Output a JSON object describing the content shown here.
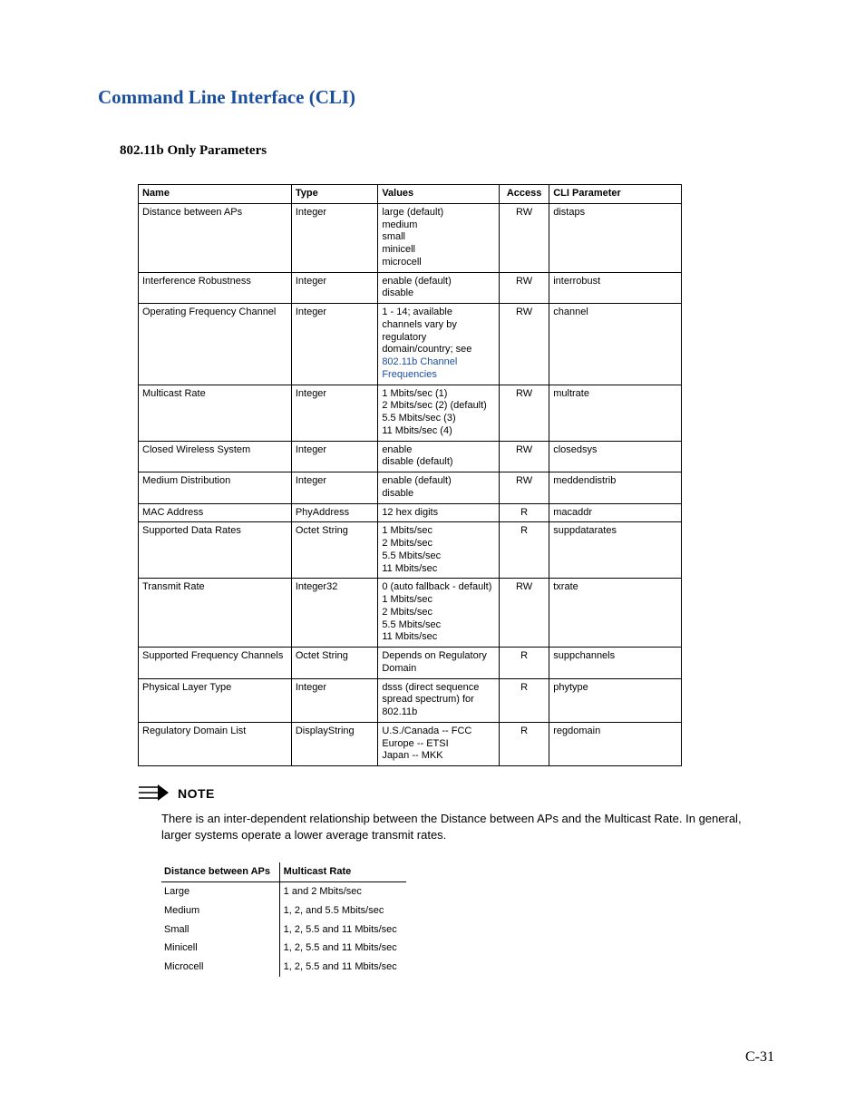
{
  "page": {
    "title": "Command Line Interface (CLI)",
    "subtitle": "802.11b Only Parameters",
    "note_label": "NOTE",
    "note_text": "There is an inter-dependent relationship between the Distance between APs and the Multicast Rate. In general, larger systems operate a lower average transmit rates.",
    "page_number": "C-31"
  },
  "params_table": {
    "headers": [
      "Name",
      "Type",
      "Values",
      "Access",
      "CLI Parameter"
    ],
    "rows": [
      {
        "name": "Distance between APs",
        "type": "Integer",
        "values_lines": [
          "large (default)",
          "medium",
          "small",
          "minicell",
          "microcell"
        ],
        "access": "RW",
        "cli": "distaps"
      },
      {
        "name": "Interference Robustness",
        "type": "Integer",
        "values_lines": [
          "enable (default)",
          "disable"
        ],
        "access": "RW",
        "cli": "interrobust"
      },
      {
        "name": "Operating Frequency Channel",
        "type": "Integer",
        "values_lines": [
          "1 - 14; available channels vary by regulatory domain/country; see"
        ],
        "values_link_lines": [
          "802.11b Channel",
          "Frequencies"
        ],
        "access": "RW",
        "cli": "channel"
      },
      {
        "name": "Multicast Rate",
        "type": "Integer",
        "values_lines": [
          "1 Mbits/sec (1)",
          "2 Mbits/sec (2) (default)",
          "5.5 Mbits/sec (3)",
          "11 Mbits/sec (4)"
        ],
        "access": "RW",
        "cli": "multrate"
      },
      {
        "name": "Closed Wireless System",
        "type": "Integer",
        "values_lines": [
          "enable",
          "disable (default)"
        ],
        "access": "RW",
        "cli": "closedsys"
      },
      {
        "name": "Medium Distribution",
        "type": "Integer",
        "values_lines": [
          "enable (default)",
          "disable"
        ],
        "access": "RW",
        "cli": "meddendistrib"
      },
      {
        "name": "MAC Address",
        "type": "PhyAddress",
        "values_lines": [
          "12 hex digits"
        ],
        "access": "R",
        "cli": "macaddr"
      },
      {
        "name": "Supported Data Rates",
        "type": "Octet String",
        "values_lines": [
          "1 Mbits/sec",
          "2 Mbits/sec",
          "5.5 Mbits/sec",
          "11 Mbits/sec"
        ],
        "access": "R",
        "cli": "suppdatarates"
      },
      {
        "name": "Transmit Rate",
        "type": "Integer32",
        "values_lines": [
          "0 (auto fallback - default)",
          "1 Mbits/sec",
          "2 Mbits/sec",
          "5.5 Mbits/sec",
          "11 Mbits/sec"
        ],
        "access": "RW",
        "cli": "txrate"
      },
      {
        "name": "Supported Frequency Channels",
        "type": "Octet String",
        "values_lines": [
          "Depends on Regulatory Domain"
        ],
        "access": "R",
        "cli": "suppchannels"
      },
      {
        "name": "Physical Layer Type",
        "type": "Integer",
        "values_lines": [
          "dsss (direct sequence spread spectrum) for 802.11b"
        ],
        "access": "R",
        "cli": "phytype"
      },
      {
        "name": "Regulatory Domain List",
        "type": "DisplayString",
        "values_lines": [
          "U.S./Canada -- FCC",
          "Europe -- ETSI",
          "Japan -- MKK"
        ],
        "access": "R",
        "cli": "regdomain"
      }
    ]
  },
  "rates_table": {
    "headers": [
      "Distance between APs",
      "Multicast Rate"
    ],
    "rows": [
      {
        "d": "Large",
        "m": "1 and 2 Mbits/sec"
      },
      {
        "d": "Medium",
        "m": "1, 2, and 5.5 Mbits/sec"
      },
      {
        "d": "Small",
        "m": "1, 2, 5.5 and 11 Mbits/sec"
      },
      {
        "d": "Minicell",
        "m": "1, 2, 5.5 and 11 Mbits/sec"
      },
      {
        "d": "Microcell",
        "m": "1, 2, 5.5 and 11 Mbits/sec"
      }
    ]
  }
}
